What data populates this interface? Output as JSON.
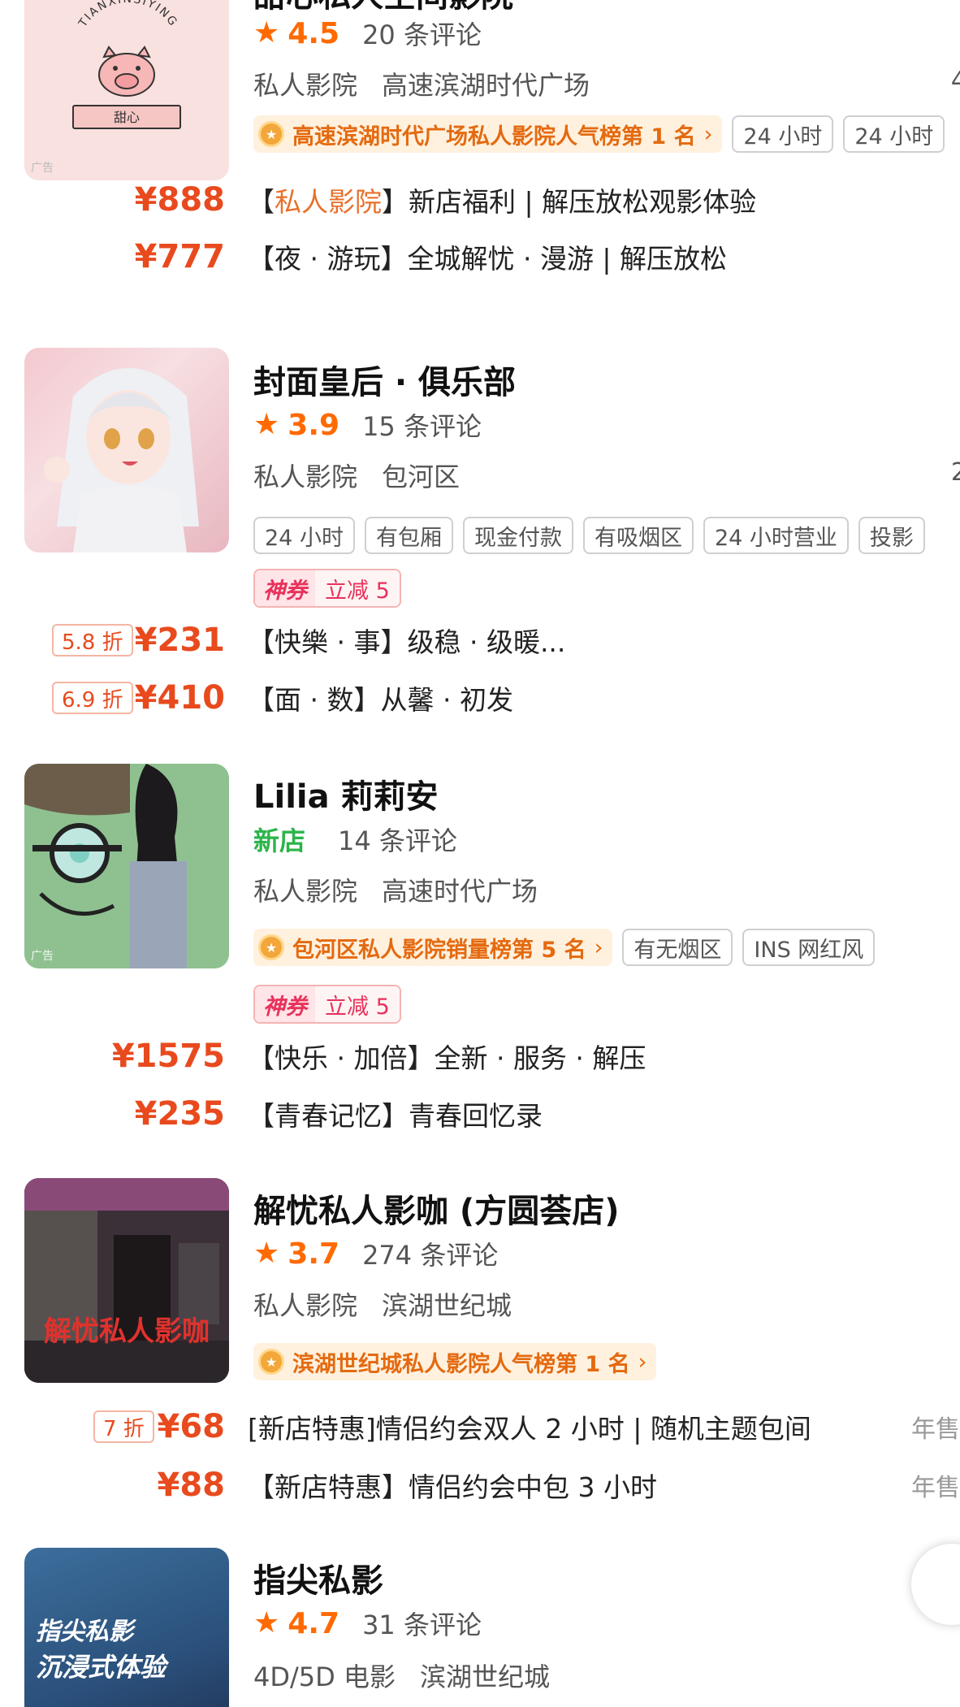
{
  "shops": [
    {
      "title": "甜心私人空间影院",
      "thumb_brand": "TIANXINSIYING",
      "thumb_sign": "甜心",
      "ad_label": "广告",
      "star": "★",
      "score": "4.5",
      "reviews": "20 条评论",
      "category": "私人影院",
      "area": "高速滨湖时代广场",
      "rank_text": "高速滨湖时代广场私人影院人气榜第 1 名",
      "tags": [
        "24 小时",
        "24 小时"
      ],
      "deals": [
        {
          "price": "¥888",
          "desc_open": "【",
          "desc_hl": "私人影院",
          "desc_rest": "】新店福利 | 解压放松观影体验"
        },
        {
          "price": "¥777",
          "desc": "【夜 · 游玩】全城解忧 · 漫游 | 解压放松"
        }
      ]
    },
    {
      "title": "封面皇后 · 俱乐部",
      "star": "★",
      "score": "3.9",
      "reviews": "15 条评论",
      "category": "私人影院",
      "area": "包河区",
      "tags": [
        "24 小时",
        "有包厢",
        "现金付款",
        "有吸烟区",
        "24 小时营业",
        "投影"
      ],
      "coupon": {
        "brand": "神券",
        "text": "立减 5"
      },
      "deals": [
        {
          "discount": "5.8 折",
          "price": "¥231",
          "desc": "【快樂 · 事】级稳 · 级暖..."
        },
        {
          "discount": "6.9 折",
          "price": "¥410",
          "desc": "【面 · 数】从馨 · 初发"
        }
      ]
    },
    {
      "title": "Lilia 莉莉安",
      "ad_label": "广告",
      "new_label": "新店",
      "reviews": "14 条评论",
      "category": "私人影院",
      "area": "高速时代广场",
      "rank_text": "包河区私人影院销量榜第 5 名",
      "tags": [
        "有无烟区",
        "INS 网红风"
      ],
      "coupon": {
        "brand": "神券",
        "text": "立减 5"
      },
      "deals": [
        {
          "price": "¥1575",
          "desc": "【快乐 · 加倍】全新 · 服务 · 解压"
        },
        {
          "price": "¥235",
          "desc": "【青春记忆】青春回忆录"
        }
      ]
    },
    {
      "title": "解忧私人影咖 (方圆荟店)",
      "thumb_sign": "解忧私人影咖",
      "star": "★",
      "score": "3.7",
      "reviews": "274 条评论",
      "category": "私人影院",
      "area": "滨湖世纪城",
      "rank_text": "滨湖世纪城私人影院人气榜第 1 名",
      "deals": [
        {
          "discount": "7 折",
          "price": "¥68",
          "desc": "[新店特惠]情侣约会双人 2 小时 | 随机主题包间",
          "sold": "年售"
        },
        {
          "price": "¥88",
          "desc": "【新店特惠】情侣约会中包 3 小时",
          "sold": "年售"
        }
      ]
    },
    {
      "title": "指尖私影",
      "thumb_line1": "指尖私影",
      "thumb_line2": "沉浸式体验",
      "star": "★",
      "score": "4.7",
      "reviews": "31 条评论",
      "category": "4D/5D 电影",
      "area": "滨湖世纪城"
    }
  ],
  "icons": {
    "medal": "medal-icon",
    "chevron": "chevron-right-icon",
    "star": "star-icon"
  },
  "colors": {
    "accent_orange": "#ff6a00",
    "price_red": "#e84a1e",
    "new_green": "#2cb44a",
    "rank_bg": "#fff1de"
  }
}
